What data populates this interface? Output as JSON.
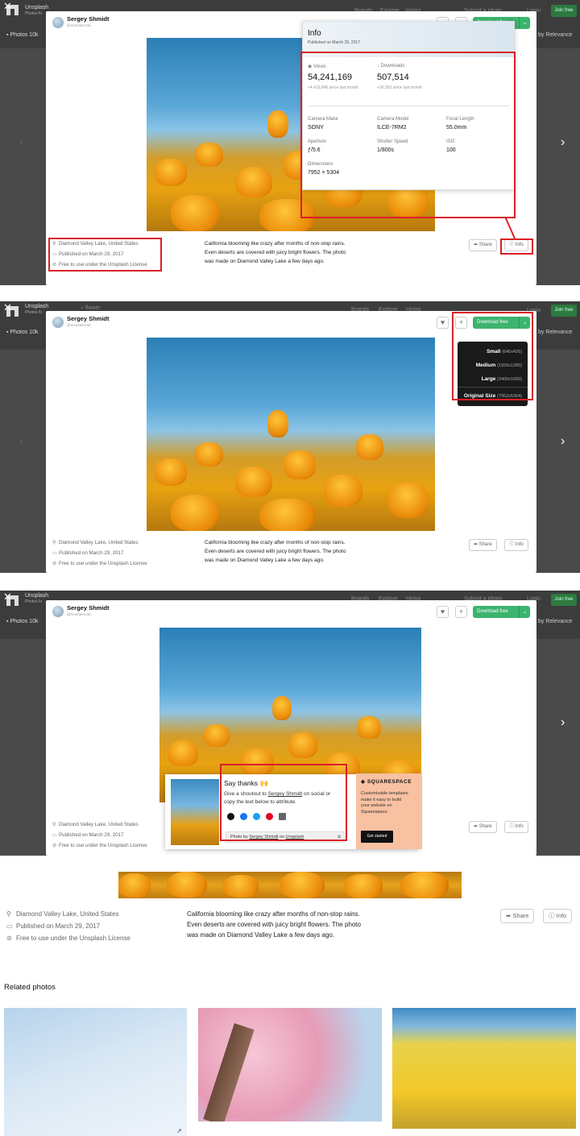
{
  "app": {
    "name": "Unsplash",
    "subtitle": "Photos fo",
    "tab": "Photos 10k",
    "search": "flower",
    "nav": [
      "Brands",
      "Explore",
      "Hiring"
    ],
    "submit": "Submit a photo",
    "login": "Login",
    "join": "Join free",
    "relevance": "by Relevance"
  },
  "photographer": {
    "name": "Sergey Shmidt",
    "handle": "@monstercritic"
  },
  "actions": {
    "download": "Download free",
    "share": "Share",
    "info": "Info"
  },
  "meta": {
    "location": "Diamond Valley Lake, United States",
    "published": "Published on March 29, 2017",
    "license": "Free to use under the Unsplash License"
  },
  "description": [
    "California blooming like crazy after months of non-stop rains.",
    "Even deserts are covered with juicy bright flowers. The photo",
    "was made on Diamond Valley Lake a few days ago."
  ],
  "info_panel": {
    "title": "Info",
    "published": "Published on March 29, 2017",
    "views_label": "Views",
    "views": "54,241,169",
    "views_delta": "+4,416,846 since last month",
    "downloads_label": "Downloads",
    "downloads": "507,514",
    "downloads_delta": "+36,353 since last month",
    "camera_make_label": "Camera Make",
    "camera_make": "SONY",
    "camera_model_label": "Camera Model",
    "camera_model": "ILCE-7RM2",
    "focal_label": "Focal Length",
    "focal": "55.0mm",
    "aperture_label": "Aperture",
    "aperture": "ƒ/5.6",
    "shutter_label": "Shutter Speed",
    "shutter": "1/800s",
    "iso_label": "ISO",
    "iso": "100",
    "dimensions_label": "Dimensions",
    "dimensions": "7952 × 5304"
  },
  "download_menu": [
    {
      "name": "Small",
      "size": "(640x426)"
    },
    {
      "name": "Medium",
      "size": "(1920x1280)"
    },
    {
      "name": "Large",
      "size": "(2400x1600)"
    },
    {
      "name": "Original Size",
      "size": "(7952x5304)"
    }
  ],
  "say_thanks": {
    "title": "Say thanks",
    "emoji": "🙌",
    "line1_pre": "Give a shoutout to ",
    "line1_link": "Sergey Shmidt",
    "line1_post": " on social or",
    "line2": "copy the text below to attribute.",
    "credit_pre": "Photo by ",
    "credit_name": "Sergey Shmidt",
    "credit_mid": " on ",
    "credit_site": "Unsplash"
  },
  "squarespace": {
    "brand": "SQUARESPACE",
    "text": [
      "Customizable templates",
      "make it easy to build",
      "your website on",
      "Squarespace."
    ],
    "cta": "Get started"
  },
  "related": {
    "title": "Related photos"
  }
}
